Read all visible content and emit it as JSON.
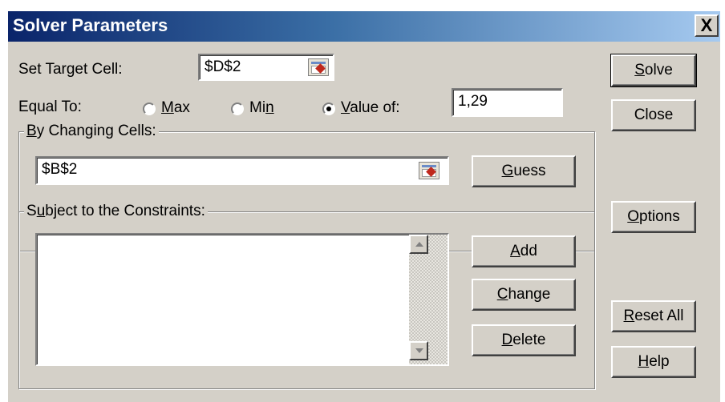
{
  "window": {
    "title": "Solver Parameters",
    "close_glyph": "X",
    "title_colors": [
      "#0a246a",
      "#a6caf0"
    ]
  },
  "target": {
    "label_pre": "Set Target Cell:",
    "value": "$D$2"
  },
  "equal_to": {
    "label": "Equal To:",
    "options": [
      {
        "mnemonic": "M",
        "rest": "ax",
        "selected": false
      },
      {
        "pre": "Mi",
        "mnemonic": "n",
        "selected": false
      },
      {
        "mnemonic": "V",
        "rest": "alue of:",
        "selected": true
      }
    ],
    "value": "1,29"
  },
  "changing": {
    "group_mnemonic": "B",
    "group_rest": "y Changing Cells:",
    "value": "$B$2",
    "guess": {
      "mnemonic": "G",
      "rest": "uess"
    }
  },
  "constraints": {
    "group_pre": "S",
    "group_mnemonic": "u",
    "group_rest": "bject to the Constraints:",
    "add": {
      "mnemonic": "A",
      "rest": "dd"
    },
    "change": {
      "mnemonic": "C",
      "rest": "hange"
    },
    "delete": {
      "mnemonic": "D",
      "rest": "elete"
    }
  },
  "side_buttons": {
    "solve": {
      "mnemonic": "S",
      "rest": "olve"
    },
    "close": "Close",
    "options": {
      "mnemonic": "O",
      "rest": "ptions"
    },
    "reset": {
      "mnemonic": "R",
      "rest": "eset All"
    },
    "help": {
      "mnemonic": "H",
      "rest": "elp"
    }
  },
  "icons": [
    "cell-reference-icon",
    "scroll-up-icon",
    "scroll-down-icon",
    "close-icon"
  ]
}
